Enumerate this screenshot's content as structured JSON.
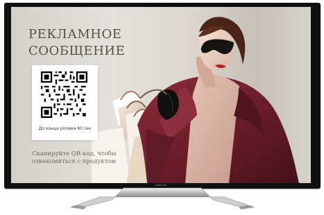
{
  "tv": {
    "brand_logo_text": "SAMSUNG"
  },
  "ad": {
    "headline_line_1": "РЕКЛАМНОЕ",
    "headline_line_2": "СООБЩЕНИЕ",
    "qr_caption": "До конца ролика 60 сек",
    "subtext_line_1": "Сканируйте QR-код, чтобы",
    "subtext_line_2": "ознакомиться с продуктом"
  },
  "colors": {
    "screen_background": "#dcd8d1",
    "coat": "#6f1f2b",
    "headline_text": "#555049",
    "bezel": "#101010"
  },
  "icons": {
    "qr": "qr-code-icon",
    "brand": "samsung-logo-icon"
  }
}
